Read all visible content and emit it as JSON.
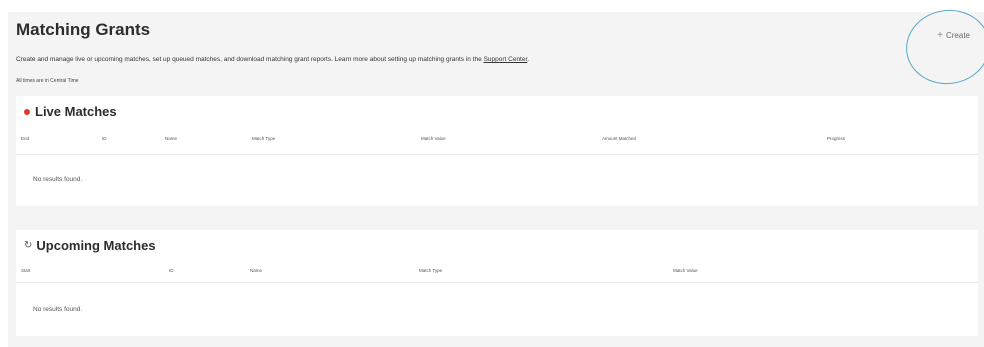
{
  "header": {
    "title": "Matching Grants",
    "create_label": "Create",
    "create_icon": "plus-icon",
    "description_text": "Create and manage live or upcoming matches, set up queued matches, and download matching grant reports. Learn more about setting up matching grants in the ",
    "support_link": "Support Center",
    "description_end": ".",
    "timezone_note": "All times are in Central Time"
  },
  "live": {
    "title": "Live Matches",
    "status_color": "#e03a2e",
    "columns": [
      "End",
      "ID",
      "Name",
      "Match Type",
      "Match Value",
      "Amount Matched",
      "Progress"
    ],
    "empty_text": "No results found."
  },
  "upcoming": {
    "title": "Upcoming Matches",
    "icon": "refresh-icon",
    "columns": [
      "Start",
      "ID",
      "Name",
      "Match Type",
      "Match Value"
    ],
    "empty_text": "No results found."
  }
}
